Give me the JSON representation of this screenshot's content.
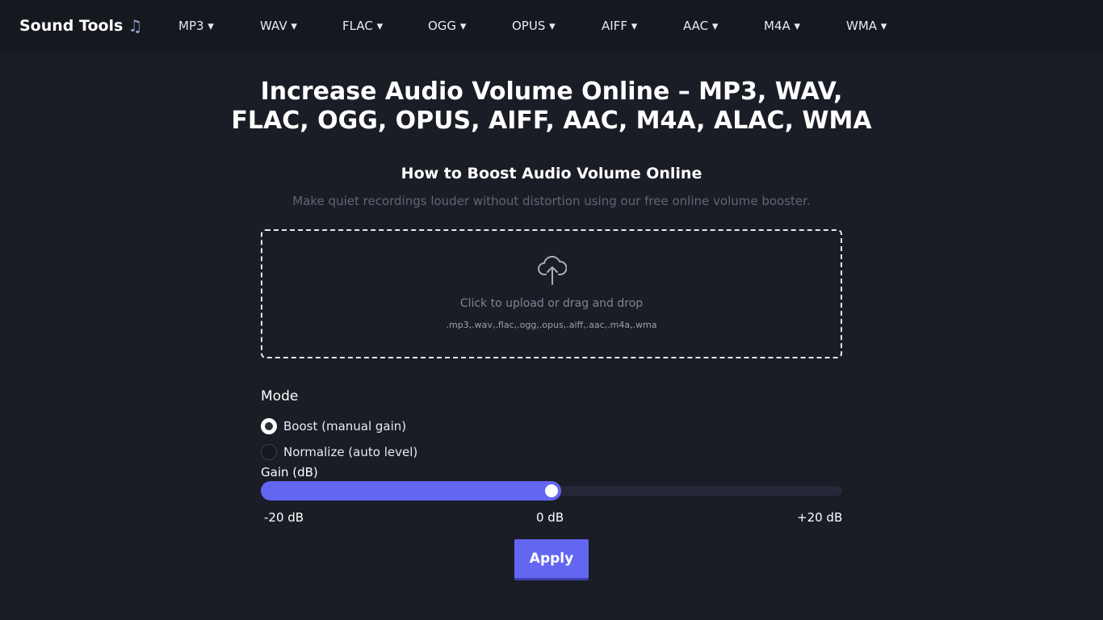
{
  "header": {
    "brand": "Sound Tools",
    "brand_icon": "music-note-icon",
    "nav_items": [
      "MP3 ▾",
      "WAV ▾",
      "FLAC ▾",
      "OGG ▾",
      "OPUS ▾",
      "AIFF ▾",
      "AAC ▾",
      "M4A ▾",
      "WMA ▾"
    ]
  },
  "main": {
    "title": "Increase Audio Volume Online – MP3, WAV, FLAC, OGG, OPUS, AIFF, AAC, M4A, ALAC, WMA",
    "section_title": "How to Boost Audio Volume Online",
    "section_subtitle": "Make quiet recordings louder without distortion using our free online volume booster."
  },
  "upload": {
    "icon": "cloud-upload-icon",
    "text": "Click to upload or drag and drop",
    "formats": ".mp3,.wav,.flac,.ogg,.opus,.aiff,.aac,.m4a,.wma"
  },
  "mode": {
    "label": "Mode",
    "options": [
      {
        "label": "Boost (manual gain)",
        "checked": true
      },
      {
        "label": "Normalize (auto level)",
        "checked": false
      }
    ]
  },
  "gain": {
    "label": "Gain (dB)",
    "min": -20,
    "max": 20,
    "value": 0,
    "min_label": "-20 dB",
    "mid_label": "0 dB",
    "max_label": "+20 dB"
  },
  "actions": {
    "apply_label": "Apply"
  },
  "colors": {
    "accent": "#6366f1",
    "background": "#1a1d25",
    "navbar": "#15181e"
  }
}
